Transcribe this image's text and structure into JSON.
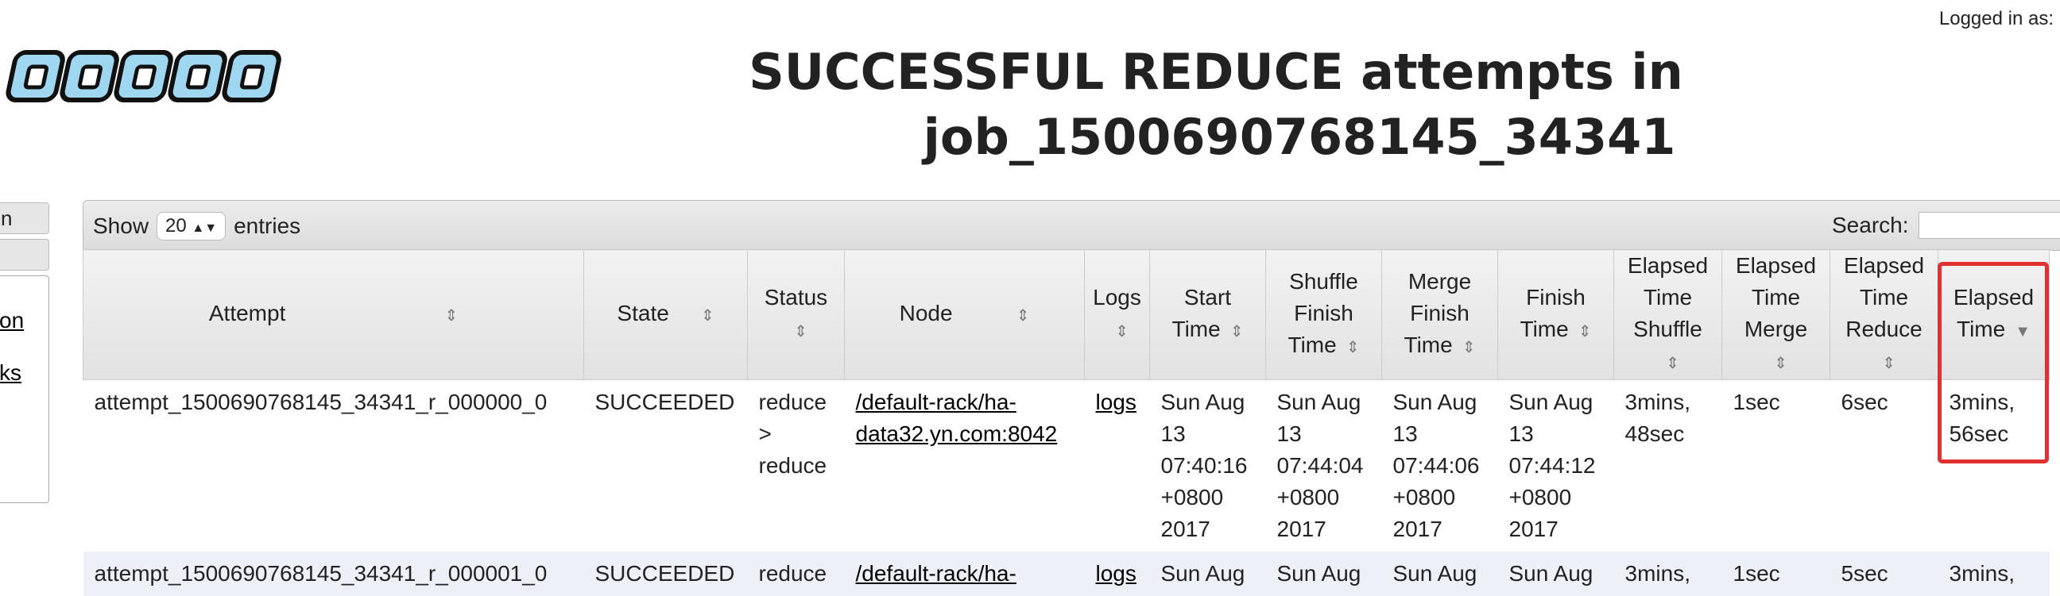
{
  "header": {
    "logged_in": "Logged in as:",
    "title_line1": "SUCCESSFUL REDUCE attempts in",
    "title_line2": "job_1500690768145_34341",
    "logo_text": "hadoop"
  },
  "leftnav": {
    "btn1": "n",
    "btn2": "",
    "links": [
      "on",
      "ks"
    ]
  },
  "toolbar": {
    "show_label": "Show",
    "entries_value": "20",
    "entries_label": "entries",
    "search_label": "Search:",
    "search_value": ""
  },
  "table": {
    "headers": [
      "Attempt",
      "State",
      "Status",
      "Node",
      "Logs",
      "Start Time",
      "Shuffle Finish Time",
      "Merge Finish Time",
      "Finish Time",
      "Elapsed Time Shuffle",
      "Elapsed Time Merge",
      "Elapsed Time Reduce",
      "Elapsed Time"
    ],
    "rows": [
      {
        "attempt": "attempt_1500690768145_34341_r_000000_0",
        "state": "SUCCEEDED",
        "status": "reduce > reduce",
        "node": "/default-rack/ha-data32.yn.com:8042",
        "logs": "logs",
        "start": "Sun Aug 13 07:40:16 +0800 2017",
        "shuffle_finish": "Sun Aug 13 07:44:04 +0800 2017",
        "merge_finish": "Sun Aug 13 07:44:06 +0800 2017",
        "finish": "Sun Aug 13 07:44:12 +0800 2017",
        "el_shuffle": "3mins, 48sec",
        "el_merge": "1sec",
        "el_reduce": "6sec",
        "elapsed": "3mins, 56sec"
      },
      {
        "attempt": "attempt_1500690768145_34341_r_000001_0",
        "state": "SUCCEEDED",
        "status": "reduce",
        "node": "/default-rack/ha-",
        "logs": "logs",
        "start": "Sun Aug",
        "shuffle_finish": "Sun Aug",
        "merge_finish": "Sun Aug",
        "finish": "Sun Aug",
        "el_shuffle": "3mins,",
        "el_merge": "1sec",
        "el_reduce": "5sec",
        "elapsed": "3mins,"
      }
    ]
  }
}
